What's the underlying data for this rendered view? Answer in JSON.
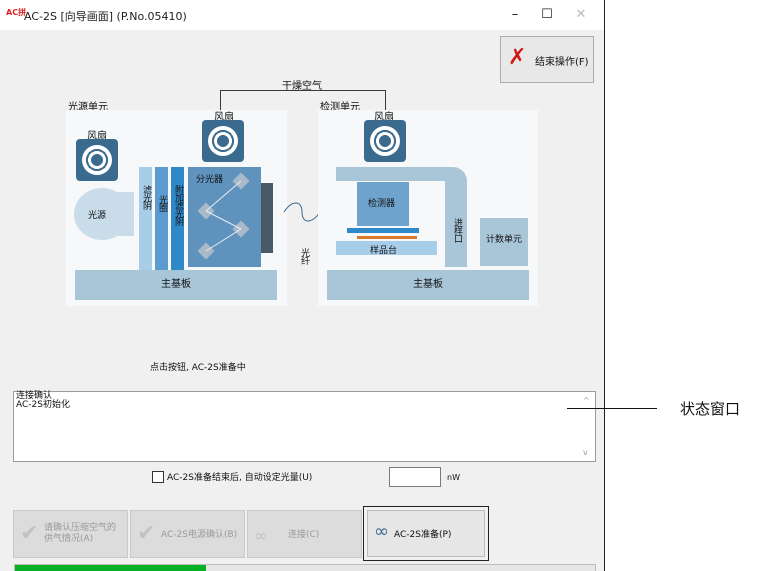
{
  "window": {
    "app_icon": "AC拼",
    "title": "AC-2S [向导画面] (P.No.05410)",
    "minimize": "–",
    "maximize": "☐",
    "close": "✕"
  },
  "end_button": {
    "icon": "x-mark-icon",
    "label": "结束操作(F)"
  },
  "diagram": {
    "dry_air": "干燥空气",
    "light_unit": {
      "title": "光源单元",
      "fan": "风扇",
      "light_source": "光源",
      "filter1": "滤光阴",
      "aperture": "光圈",
      "filter2": "附加滤光阴",
      "splitter": "分光器",
      "mainboard": "主基板"
    },
    "fiber": "光纤",
    "detect_unit": {
      "title": "检测单元",
      "fan": "风扇",
      "detector": "检测器",
      "stage": "样品台",
      "inlet": "进样口",
      "counter": "计数单元",
      "mainboard": "主基板"
    }
  },
  "status_message": "点击按钮, AC-2S准备中",
  "status_window": {
    "lines": [
      "连接确认",
      "AC-2S初始化"
    ],
    "scroll_up": "^",
    "scroll_down": "v"
  },
  "auto_set": {
    "checked": false,
    "label": "AC-2S准备结束后, 自动设定光量(U)",
    "value": "",
    "unit": "nW"
  },
  "steps": {
    "air_check": "请确认压缩空气的供气情况(A)",
    "power_check": "AC-2S电源确认(B)",
    "connect": "连接(C)",
    "ready": "AC-2S准备(P)"
  },
  "progress": {
    "percent": 33
  },
  "annotation": {
    "label": "状态窗口"
  },
  "colors": {
    "accent": "#3a6a8e",
    "progress": "#06b025",
    "end_x": "#d01818"
  }
}
